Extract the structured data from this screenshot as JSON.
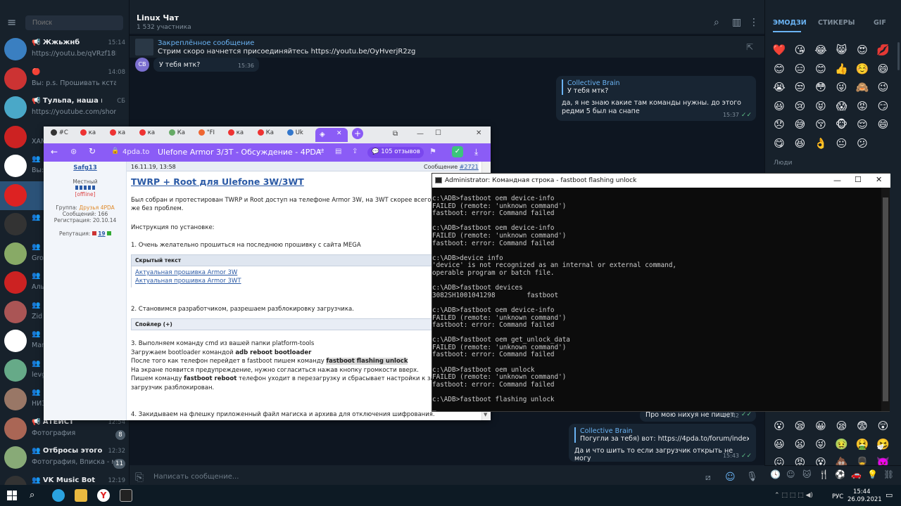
{
  "sidebar": {
    "search_placeholder": "Поиск",
    "chats": [
      {
        "name": "📢 Жжьжнб",
        "msg": "https://youtu.be/qVRzf18F...",
        "time": "15:14",
        "badge": ""
      },
      {
        "name": "🔴",
        "msg": "Вы: p.s. Прошивать кстат...",
        "time": "14:08",
        "badge": ""
      },
      {
        "name": "📢 Тульпа, наша исто...",
        "msg": "https://youtube.com/short...",
        "time": "СБ",
        "badge": ""
      },
      {
        "name": "",
        "msg": "ХАМ",
        "time": "",
        "badge": ""
      },
      {
        "name": "👥",
        "msg": "Вы:",
        "time": "",
        "badge": ""
      },
      {
        "name": "",
        "msg": "",
        "time": "",
        "badge": ""
      },
      {
        "name": "👥",
        "msg": "",
        "time": "",
        "badge": ""
      },
      {
        "name": "👥",
        "msg": "Gro",
        "time": "",
        "badge": ""
      },
      {
        "name": "👥",
        "msg": "Аль",
        "time": "",
        "badge": ""
      },
      {
        "name": "👥",
        "msg": "Žid",
        "time": "",
        "badge": ""
      },
      {
        "name": "👥",
        "msg": "Mar",
        "time": "",
        "badge": ""
      },
      {
        "name": "👥",
        "msg": "levg",
        "time": "",
        "badge": ""
      },
      {
        "name": "👥",
        "msg": "НИЗ",
        "time": "",
        "badge": ""
      },
      {
        "name": "📢 АТЕИСТ",
        "msg": "Фотография",
        "time": "12:54",
        "badge": "8"
      },
      {
        "name": "👥 Отбросы этого пок...",
        "msg": "Фотография, Вписка - ме...",
        "time": "12:32",
        "badge": "11"
      },
      {
        "name": "👥 VK Music Bot",
        "msg": "",
        "time": "12:19",
        "badge": ""
      }
    ]
  },
  "main": {
    "title": "Linux Чат",
    "subtitle": "1 532 участника",
    "pinned_title": "Закреплённое сообщение",
    "pinned_text": "Стрим скоро начнется присоединяйтесь https://youtu.be/OyHverjR2zg",
    "msg1_avatar": "CB",
    "msg1_text": "У тебя мтк?",
    "msg1_time": "15:36",
    "reply1_name": "Collective Brain",
    "reply1_quote": "У тебя мтк?",
    "reply1_text": "да, я не знаю какие там команды нужны. до этого редми 5 был на снапе",
    "reply1_time": "15:37",
    "msg2_text": "Про мою нихуя не пишет",
    "msg2_time": "15:42",
    "reply2_name": "Collective Brain",
    "reply2_quote": "Погугли за тебя) вот: https://4pda.to/forum/index.php?sh...",
    "reply2_text": "Да и что шить то если загрузчик открыть не могу",
    "reply2_time": "15:43",
    "input_placeholder": "Написать сообщение..."
  },
  "rpanel": {
    "tab_emoji": "ЭМОДЗИ",
    "tab_stickers": "СТИКЕРЫ",
    "tab_gif": "GIF",
    "people_label": "Люди",
    "emoji_rows": [
      [
        "❤️",
        "😘",
        "😂",
        "😸",
        "😍",
        "💋"
      ],
      [
        "😊",
        "😑",
        "😊",
        "👍",
        "☺️",
        "😄"
      ],
      [
        "😭",
        "😒",
        "😳",
        "😜",
        "🙈",
        "😉"
      ],
      [
        "😃",
        "😢",
        "😝",
        "😱",
        "😡",
        "😏"
      ],
      [
        "😞",
        "😅",
        "😚",
        "🐵",
        "😌",
        "😄"
      ],
      [
        "😋",
        "😆",
        "👌",
        "😐",
        "😕",
        ""
      ]
    ],
    "emoji_bottom_rows": [
      [
        "😮",
        "😪",
        "😀",
        "😪",
        "😨",
        "😲"
      ],
      [
        "😃",
        "😦",
        "😜",
        "🤢",
        "🤮",
        "🤧"
      ],
      [
        "😖",
        "😡",
        "😵",
        "💩",
        "💂",
        "👿"
      ]
    ]
  },
  "browser": {
    "tabs": [
      "#C",
      "ка",
      "ка",
      "ка",
      "Ка",
      "\"FI",
      "ка",
      "Ка",
      "Uk"
    ],
    "url": "4pda.to",
    "page_title": "Ulefone Armor 3/3T - Обсуждение - 4PDA",
    "reviews": "105 отзывов",
    "user": "Safg13",
    "user_rank": "Местный",
    "user_status": "[offline]",
    "user_group_label": "Группа:",
    "user_group": "Друзья 4PDA",
    "user_posts": "Сообщений: 166",
    "user_reg": "Регистрация: 20.10.14",
    "user_rep_label": "Репутация:",
    "user_rep": "19",
    "post_date": "16.11.19, 13:58",
    "post_msg_label": "Сообщение",
    "post_num": "#2721",
    "post_heading": "TWRP + Root для Ulefone 3W/3WT",
    "p1": "Был собран и протестирован TWRP и Root доступ на телефоне Armor 3W, на 3WT скорее всего будет",
    "p1b": "же без проблем.",
    "p2": "Инструкция по установке:",
    "p3": "1. Очень желательно прошиться на последнюю прошивку с сайта MEGA",
    "hidden_label": "Скрытый текст",
    "hidden_l1": "Актуальная прошивка Armor 3W",
    "hidden_l2": "Актуальная прошивка Armor 3WT",
    "p4": "2. Становимся разработчиком, разрешаем разблокировку загрузчика.",
    "spoiler_label": "Спойлер (+)",
    "p5": "3. Выполняем команду cmd из вашей папки platform-tools",
    "p6a": "Загружаем bootloader командой ",
    "p6b": "adb reboot bootloader",
    "p7a": "После того как телефон перейдет в fastboot пишем команду ",
    "p7b": "fastboot flashing unlock",
    "p8": "На экране появится предупреждение, нужно согласиться нажав кнопку громкости вверх.",
    "p9a": "Пишем команду ",
    "p9b": "fastboot reboot",
    "p9c": " телефон уходит в перезагрузку и сбрасывает настройки к заводским",
    "p10": "загрузчик разблокирован.",
    "p11": "4. Закидываем на флешку приложенный файл магиска и архива для отключения шифрования."
  },
  "cmd": {
    "title": "Administrator: Командная строка - fastboot  flashing unlock",
    "output": "c:\\ADB>fastboot oem device-info\nFAILED (remote: 'unknown command')\nfastboot: error: Command failed\n\nc:\\ADB>fastboot oem device-info\nFAILED (remote: 'unknown command')\nfastboot: error: Command failed\n\nc:\\ADB>device info\n'device' is not recognized as an internal or external command,\noperable program or batch file.\n\nc:\\ADB>fastboot devices\n3082SH1001041298        fastboot\n\nc:\\ADB>fastboot oem device-info\nFAILED (remote: 'unknown command')\nfastboot: error: Command failed\n\nc:\\ADB>fastboot oem get_unlock_data\nFAILED (remote: 'unknown command')\nfastboot: error: Command failed\n\nc:\\ADB>fastboot oem unlock\nFAILED (remote: 'unknown command')\nfastboot: error: Command failed\n\nc:\\ADB>fastboot flashing unlock\n_"
  },
  "taskbar": {
    "lang": "РУС",
    "time": "15:44",
    "date": "26.09.2021"
  },
  "colors": {
    "accent": "#6ab3f3",
    "sidebar_bg": "#17212b",
    "chat_bg": "#0e1621",
    "browser_accent": "#8b5cf6"
  }
}
